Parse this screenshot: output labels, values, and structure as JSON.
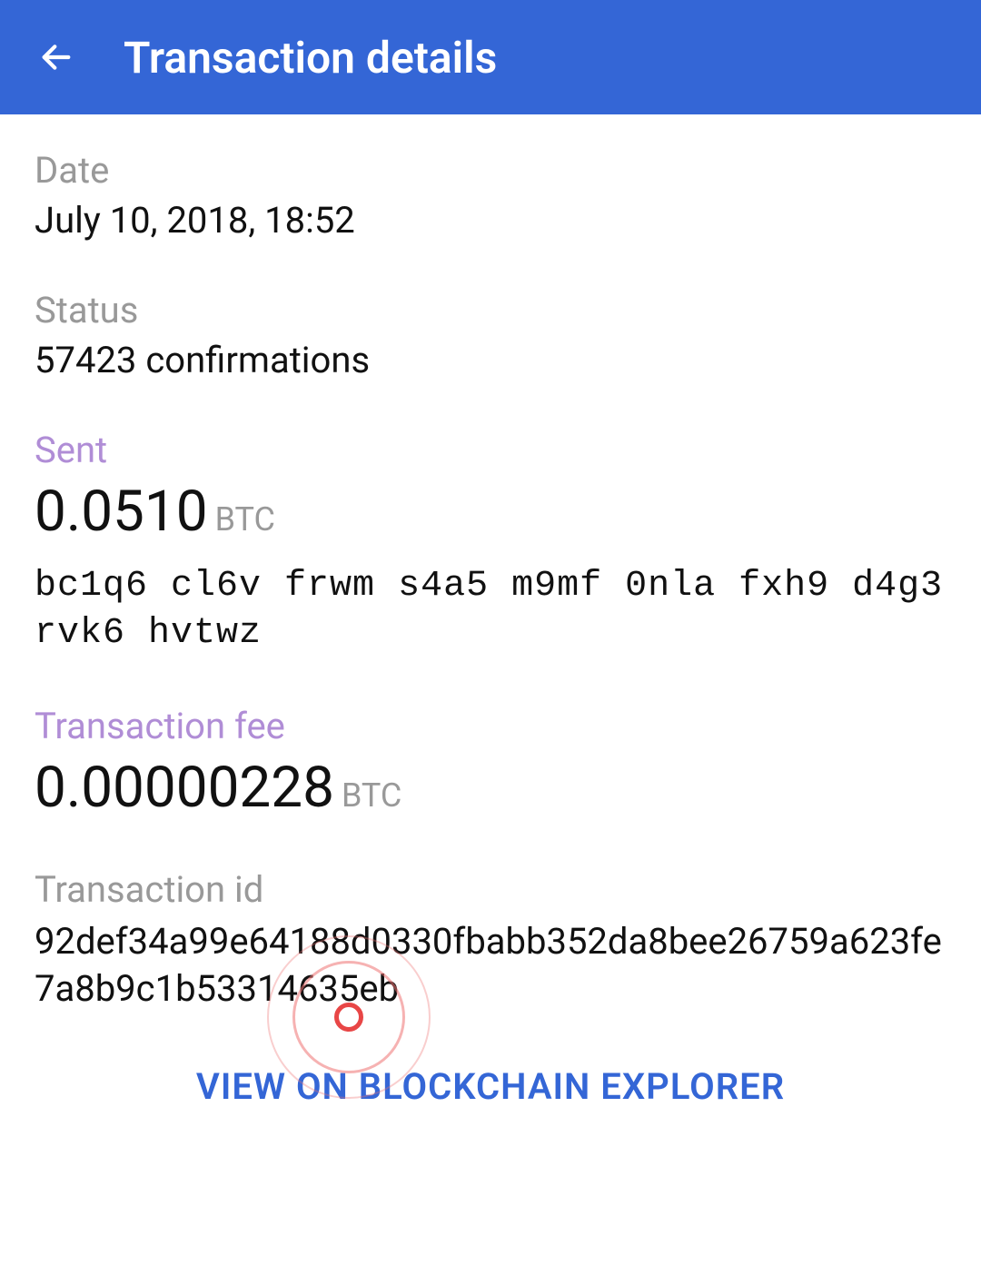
{
  "header": {
    "title": "Transaction details"
  },
  "date": {
    "label": "Date",
    "value": "July 10, 2018, 18:52"
  },
  "status": {
    "label": "Status",
    "value": "57423 confirmations"
  },
  "sent": {
    "label": "Sent",
    "amount": "0.0510",
    "currency": "BTC",
    "address": "bc1q6 cl6v frwm s4a5 m9mf 0nla fxh9 d4g3 rvk6 hvtwz"
  },
  "fee": {
    "label": "Transaction fee",
    "amount": "0.00000228",
    "currency": "BTC"
  },
  "txid": {
    "label": "Transaction id",
    "value": "92def34a99e64188d0330fbabb352da8bee26759a623fe7a8b9c1b53314635eb"
  },
  "explorer_link": "VIEW ON BLOCKCHAIN EXPLORER"
}
